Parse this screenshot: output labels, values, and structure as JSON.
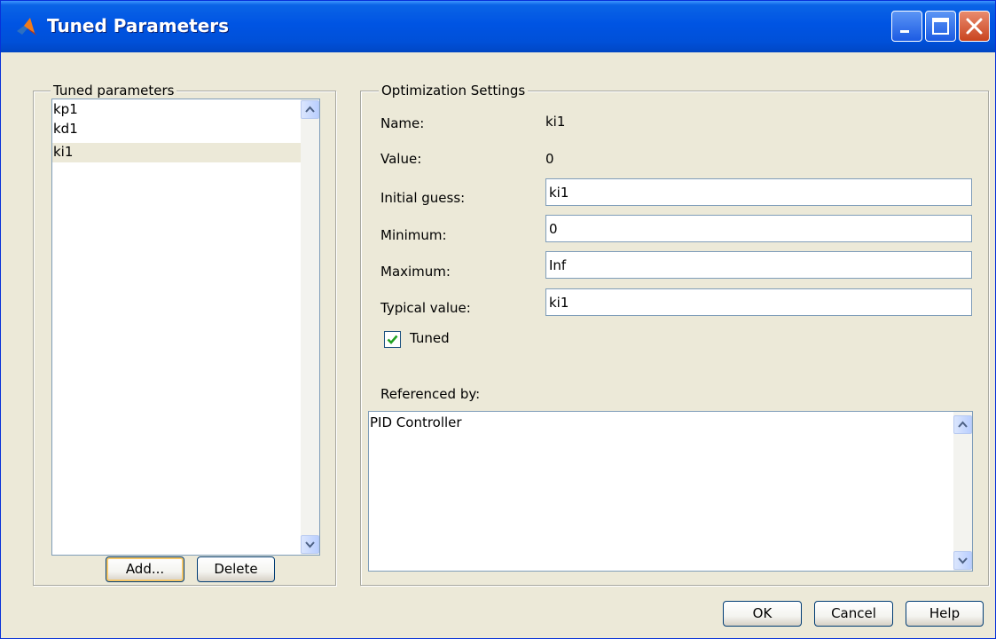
{
  "window": {
    "title": "Tuned Parameters"
  },
  "params_group": {
    "legend": "Tuned parameters",
    "items": [
      {
        "label": "kp1",
        "selected": false
      },
      {
        "label": "kd1",
        "selected": false
      },
      {
        "label": "ki1",
        "selected": true
      }
    ],
    "add_label": "Add...",
    "delete_label": "Delete"
  },
  "settings": {
    "legend": "Optimization Settings",
    "name_label": "Name:",
    "name_value": "ki1",
    "value_label": "Value:",
    "value_value": "0",
    "initial_guess_label": "Initial guess:",
    "initial_guess_value": "ki1",
    "minimum_label": "Minimum:",
    "minimum_value": "0",
    "maximum_label": "Maximum:",
    "maximum_value": "Inf",
    "typical_label": "Typical value:",
    "typical_value": "ki1",
    "tuned_label": "Tuned",
    "tuned_checked": true,
    "referenced_label": "Referenced by:",
    "referenced_items": [
      "PID Controller"
    ]
  },
  "footer": {
    "ok_label": "OK",
    "cancel_label": "Cancel",
    "help_label": "Help"
  },
  "colors": {
    "titlebar": "#0054e3",
    "dialog_bg": "#ece9d8",
    "selection_bg": "#ece9d8",
    "check_mark": "#21a121"
  }
}
